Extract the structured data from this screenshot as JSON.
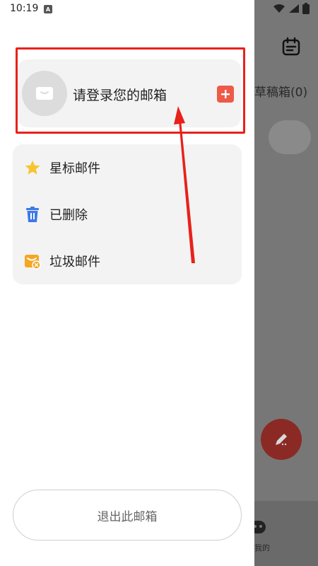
{
  "status_bar": {
    "time": "10:19"
  },
  "background_app": {
    "drafts_label": "草稿箱(0)",
    "bottom_tab_label": "我的"
  },
  "account": {
    "login_prompt": "请登录您的邮箱"
  },
  "folders": {
    "items": [
      {
        "label": "星标邮件",
        "icon": "star-icon"
      },
      {
        "label": "已删除",
        "icon": "trash-icon"
      },
      {
        "label": "垃圾邮件",
        "icon": "spam-icon"
      }
    ]
  },
  "actions": {
    "logout_label": "退出此邮箱"
  },
  "colors": {
    "highlight": "#e8211a",
    "plus_button": "#ee5a48",
    "star": "#f7c531",
    "trash": "#3b7ae8",
    "spam": "#f5a623",
    "fab": "#c0392b"
  }
}
